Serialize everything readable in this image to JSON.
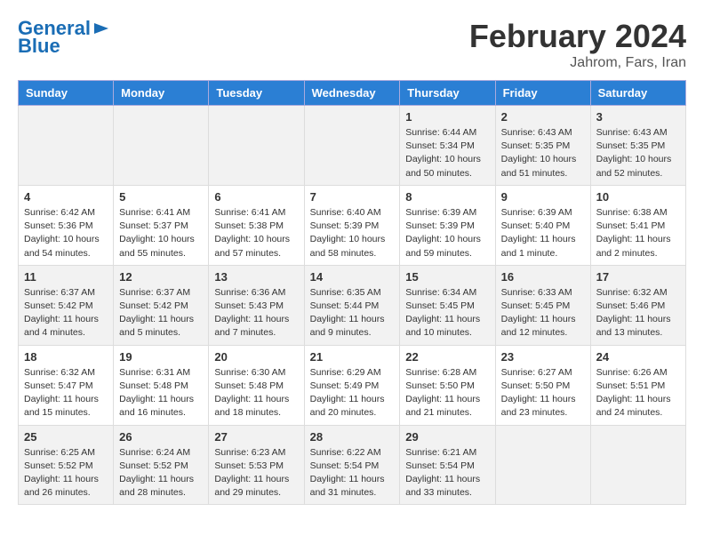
{
  "header": {
    "logo_line1": "General",
    "logo_line2": "Blue",
    "month_title": "February 2024",
    "subtitle": "Jahrom, Fars, Iran"
  },
  "weekdays": [
    "Sunday",
    "Monday",
    "Tuesday",
    "Wednesday",
    "Thursday",
    "Friday",
    "Saturday"
  ],
  "weeks": [
    [
      {
        "day": "",
        "info": ""
      },
      {
        "day": "",
        "info": ""
      },
      {
        "day": "",
        "info": ""
      },
      {
        "day": "",
        "info": ""
      },
      {
        "day": "1",
        "info": "Sunrise: 6:44 AM\nSunset: 5:34 PM\nDaylight: 10 hours\nand 50 minutes."
      },
      {
        "day": "2",
        "info": "Sunrise: 6:43 AM\nSunset: 5:35 PM\nDaylight: 10 hours\nand 51 minutes."
      },
      {
        "day": "3",
        "info": "Sunrise: 6:43 AM\nSunset: 5:35 PM\nDaylight: 10 hours\nand 52 minutes."
      }
    ],
    [
      {
        "day": "4",
        "info": "Sunrise: 6:42 AM\nSunset: 5:36 PM\nDaylight: 10 hours\nand 54 minutes."
      },
      {
        "day": "5",
        "info": "Sunrise: 6:41 AM\nSunset: 5:37 PM\nDaylight: 10 hours\nand 55 minutes."
      },
      {
        "day": "6",
        "info": "Sunrise: 6:41 AM\nSunset: 5:38 PM\nDaylight: 10 hours\nand 57 minutes."
      },
      {
        "day": "7",
        "info": "Sunrise: 6:40 AM\nSunset: 5:39 PM\nDaylight: 10 hours\nand 58 minutes."
      },
      {
        "day": "8",
        "info": "Sunrise: 6:39 AM\nSunset: 5:39 PM\nDaylight: 10 hours\nand 59 minutes."
      },
      {
        "day": "9",
        "info": "Sunrise: 6:39 AM\nSunset: 5:40 PM\nDaylight: 11 hours\nand 1 minute."
      },
      {
        "day": "10",
        "info": "Sunrise: 6:38 AM\nSunset: 5:41 PM\nDaylight: 11 hours\nand 2 minutes."
      }
    ],
    [
      {
        "day": "11",
        "info": "Sunrise: 6:37 AM\nSunset: 5:42 PM\nDaylight: 11 hours\nand 4 minutes."
      },
      {
        "day": "12",
        "info": "Sunrise: 6:37 AM\nSunset: 5:42 PM\nDaylight: 11 hours\nand 5 minutes."
      },
      {
        "day": "13",
        "info": "Sunrise: 6:36 AM\nSunset: 5:43 PM\nDaylight: 11 hours\nand 7 minutes."
      },
      {
        "day": "14",
        "info": "Sunrise: 6:35 AM\nSunset: 5:44 PM\nDaylight: 11 hours\nand 9 minutes."
      },
      {
        "day": "15",
        "info": "Sunrise: 6:34 AM\nSunset: 5:45 PM\nDaylight: 11 hours\nand 10 minutes."
      },
      {
        "day": "16",
        "info": "Sunrise: 6:33 AM\nSunset: 5:45 PM\nDaylight: 11 hours\nand 12 minutes."
      },
      {
        "day": "17",
        "info": "Sunrise: 6:32 AM\nSunset: 5:46 PM\nDaylight: 11 hours\nand 13 minutes."
      }
    ],
    [
      {
        "day": "18",
        "info": "Sunrise: 6:32 AM\nSunset: 5:47 PM\nDaylight: 11 hours\nand 15 minutes."
      },
      {
        "day": "19",
        "info": "Sunrise: 6:31 AM\nSunset: 5:48 PM\nDaylight: 11 hours\nand 16 minutes."
      },
      {
        "day": "20",
        "info": "Sunrise: 6:30 AM\nSunset: 5:48 PM\nDaylight: 11 hours\nand 18 minutes."
      },
      {
        "day": "21",
        "info": "Sunrise: 6:29 AM\nSunset: 5:49 PM\nDaylight: 11 hours\nand 20 minutes."
      },
      {
        "day": "22",
        "info": "Sunrise: 6:28 AM\nSunset: 5:50 PM\nDaylight: 11 hours\nand 21 minutes."
      },
      {
        "day": "23",
        "info": "Sunrise: 6:27 AM\nSunset: 5:50 PM\nDaylight: 11 hours\nand 23 minutes."
      },
      {
        "day": "24",
        "info": "Sunrise: 6:26 AM\nSunset: 5:51 PM\nDaylight: 11 hours\nand 24 minutes."
      }
    ],
    [
      {
        "day": "25",
        "info": "Sunrise: 6:25 AM\nSunset: 5:52 PM\nDaylight: 11 hours\nand 26 minutes."
      },
      {
        "day": "26",
        "info": "Sunrise: 6:24 AM\nSunset: 5:52 PM\nDaylight: 11 hours\nand 28 minutes."
      },
      {
        "day": "27",
        "info": "Sunrise: 6:23 AM\nSunset: 5:53 PM\nDaylight: 11 hours\nand 29 minutes."
      },
      {
        "day": "28",
        "info": "Sunrise: 6:22 AM\nSunset: 5:54 PM\nDaylight: 11 hours\nand 31 minutes."
      },
      {
        "day": "29",
        "info": "Sunrise: 6:21 AM\nSunset: 5:54 PM\nDaylight: 11 hours\nand 33 minutes."
      },
      {
        "day": "",
        "info": ""
      },
      {
        "day": "",
        "info": ""
      }
    ]
  ]
}
